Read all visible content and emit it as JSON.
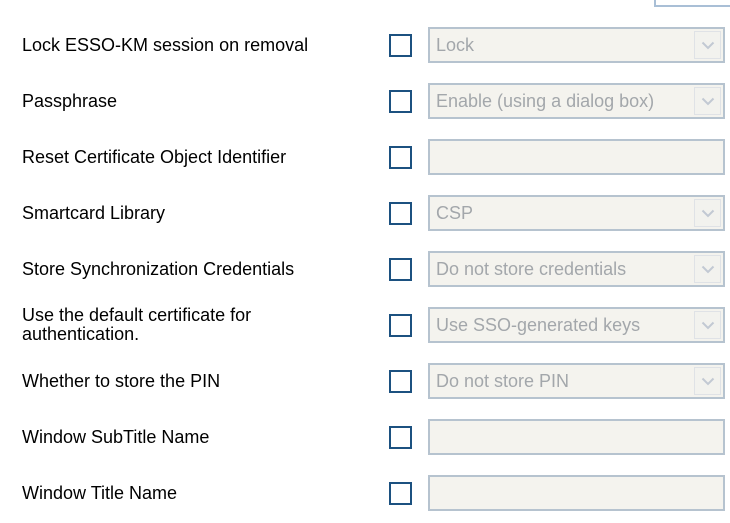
{
  "settings": [
    {
      "label": "Lock ESSO-KM session on removal",
      "control": "select",
      "value": "Lock"
    },
    {
      "label": "Passphrase",
      "control": "select",
      "value": "Enable (using a dialog box)"
    },
    {
      "label": "Reset Certificate Object Identifier",
      "control": "text",
      "value": ""
    },
    {
      "label": "Smartcard Library",
      "control": "select",
      "value": "CSP"
    },
    {
      "label": "Store Synchronization Credentials",
      "control": "select",
      "value": "Do not store credentials"
    },
    {
      "label": "Use the default certificate for authentication.",
      "control": "select",
      "value": "Use SSO-generated keys"
    },
    {
      "label": "Whether to store the PIN",
      "control": "select",
      "value": "Do not store PIN"
    },
    {
      "label": "Window SubTitle Name",
      "control": "text",
      "value": ""
    },
    {
      "label": "Window Title Name",
      "control": "text",
      "value": ""
    }
  ],
  "icons": {
    "dropdown": "chevron-down-icon"
  },
  "colors": {
    "checkbox_border": "#1c5180",
    "disabled_field_bg": "#f4f3ee",
    "disabled_text": "#a3a7ab"
  }
}
